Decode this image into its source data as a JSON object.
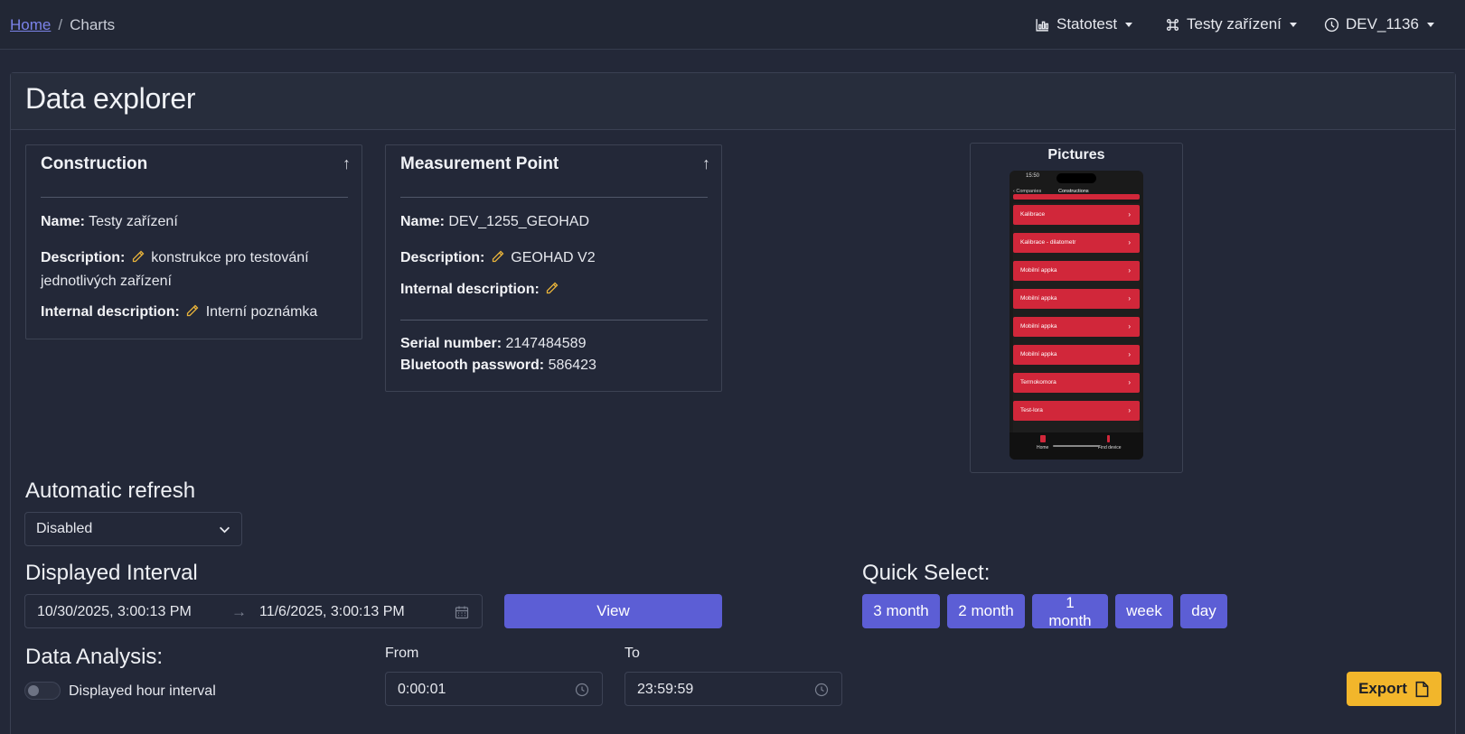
{
  "breadcrumb": {
    "home": "Home",
    "separator": "/",
    "current": "Charts"
  },
  "nav": {
    "dropdowns": [
      {
        "label": "Statotest",
        "icon": "chart-icon"
      },
      {
        "label": "Testy zařízení",
        "icon": "command-icon"
      },
      {
        "label": "DEV_1136",
        "icon": "device-icon"
      }
    ]
  },
  "page": {
    "title": "Data explorer"
  },
  "construction": {
    "title": "Construction",
    "name_label": "Name:",
    "name_value": "Testy zařízení",
    "description_label": "Description:",
    "description_value_line1": "konstrukce pro testování",
    "description_value_line2": "jednotlivých zařízení",
    "internal_label": "Internal description:",
    "internal_value": "Interní poznámka"
  },
  "measurement_point": {
    "title": "Measurement Point",
    "name_label": "Name:",
    "name_value": "DEV_1255_GEOHAD",
    "description_label": "Description:",
    "description_value": "GEOHAD V2",
    "internal_label": "Internal description:",
    "serial_label": "Serial number:",
    "serial_value": "2147484589",
    "bt_label": "Bluetooth password:",
    "bt_value": "586423"
  },
  "pictures": {
    "title": "Pictures",
    "phone": {
      "time": "15:50",
      "back": "Companies",
      "screen_title": "Constructions",
      "items": [
        "Kalibrace",
        "Kalibrace - dilatometr",
        "Mobilní appka",
        "Mobilní appka",
        "Mobilní appka",
        "Mobilní appka",
        "Termokomora",
        "Test-lora"
      ],
      "tabs": [
        "Home",
        "Find device"
      ]
    }
  },
  "refresh": {
    "title": "Automatic refresh",
    "value": "Disabled"
  },
  "interval": {
    "title": "Displayed Interval",
    "from": "10/30/2025, 3:00:13 PM",
    "arrow": "→",
    "to": "11/6/2025, 3:00:13 PM",
    "view_label": "View"
  },
  "quick_select": {
    "title": "Quick Select:",
    "buttons": [
      "3 month",
      "2 month",
      "1 month",
      "week",
      "day"
    ]
  },
  "analysis": {
    "title": "Data Analysis:",
    "toggle_label": "Displayed hour interval",
    "toggle_on": false,
    "from_label": "From",
    "from_value": "0:00:01",
    "to_label": "To",
    "to_value": "23:59:59"
  },
  "export": {
    "label": "Export"
  },
  "colors": {
    "accent": "#5c5ed5",
    "export": "#f2b62b",
    "background": "#232838",
    "pencil": "#e8b33a"
  }
}
